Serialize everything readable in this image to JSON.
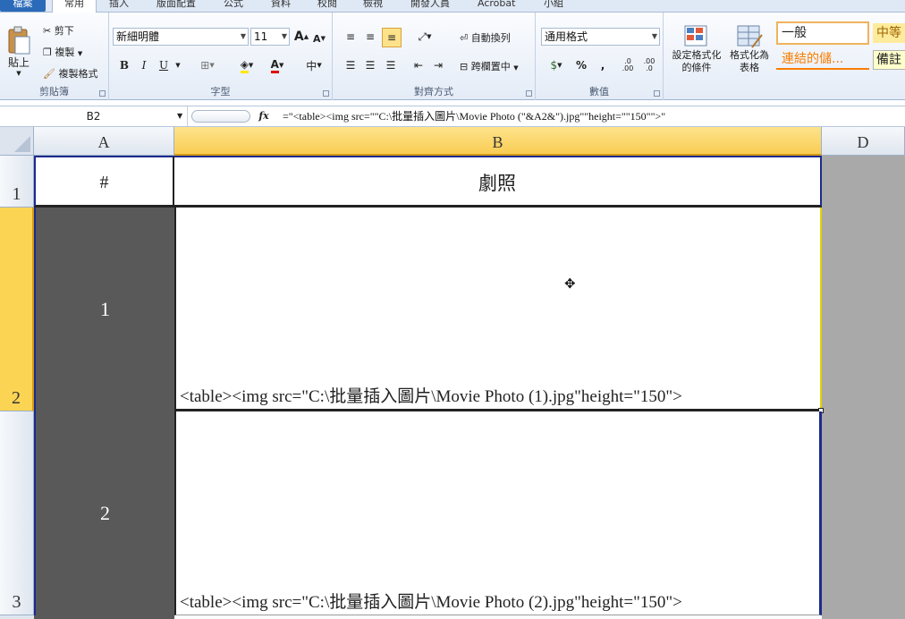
{
  "tabs": {
    "file": "檔案",
    "home": "常用",
    "insert": "插入",
    "layout": "版面配置",
    "formulas": "公式",
    "data": "資料",
    "review": "校閱",
    "view": "檢視",
    "developer": "開發人員",
    "acrobat": "Acrobat",
    "group": "小組"
  },
  "clipboard": {
    "paste": "貼上",
    "cut": "剪下",
    "copy": "複製",
    "format_painter": "複製格式",
    "label": "剪貼簿"
  },
  "font": {
    "name": "新細明體",
    "size": "11",
    "bold": "B",
    "italic": "I",
    "underline": "U",
    "label": "字型",
    "grow": "A",
    "shrink": "A",
    "color_a": "A"
  },
  "alignment": {
    "wrap": "自動換列",
    "merge": "跨欄置中",
    "label": "對齊方式"
  },
  "number": {
    "format": "通用格式",
    "percent": "%",
    "comma": ",",
    "inc": ".0 .00",
    "dec": ".00 .0",
    "label": "數值"
  },
  "styles": {
    "cond_format": "設定格式化的條件",
    "cond_format_l1": "設定格式化",
    "cond_format_l2": "的條件",
    "table_format_l1": "格式化為",
    "table_format_l2": "表格",
    "style_normal": "一般",
    "style_neutral": "中等",
    "style_link": "連結的儲...",
    "style_note": "備註"
  },
  "formula_bar": {
    "name_box": "B2",
    "fx": "fx",
    "formula": "=\"<table><img src=\"\"C:\\批量插入圖片\\Movie Photo (\"&A2&\").jpg\"\"height=\"\"150\"\">\""
  },
  "columns": [
    "A",
    "B",
    "D"
  ],
  "rows": [
    {
      "header": "1",
      "a": "#",
      "b": "劇照"
    },
    {
      "header": "2",
      "a": "1",
      "b": "<table><img src=\"C:\\批量插入圖片\\Movie Photo (1).jpg\"height=\"150\">"
    },
    {
      "header": "3",
      "a": "2",
      "b": "<table><img src=\"C:\\批量插入圖片\\Movie Photo (2).jpg\"height=\"150\">"
    }
  ],
  "colors": {
    "accent": "#2a6ab9",
    "selection": "#fcd453",
    "dark_cell": "#595959",
    "gray_area": "#a9a9a9"
  }
}
